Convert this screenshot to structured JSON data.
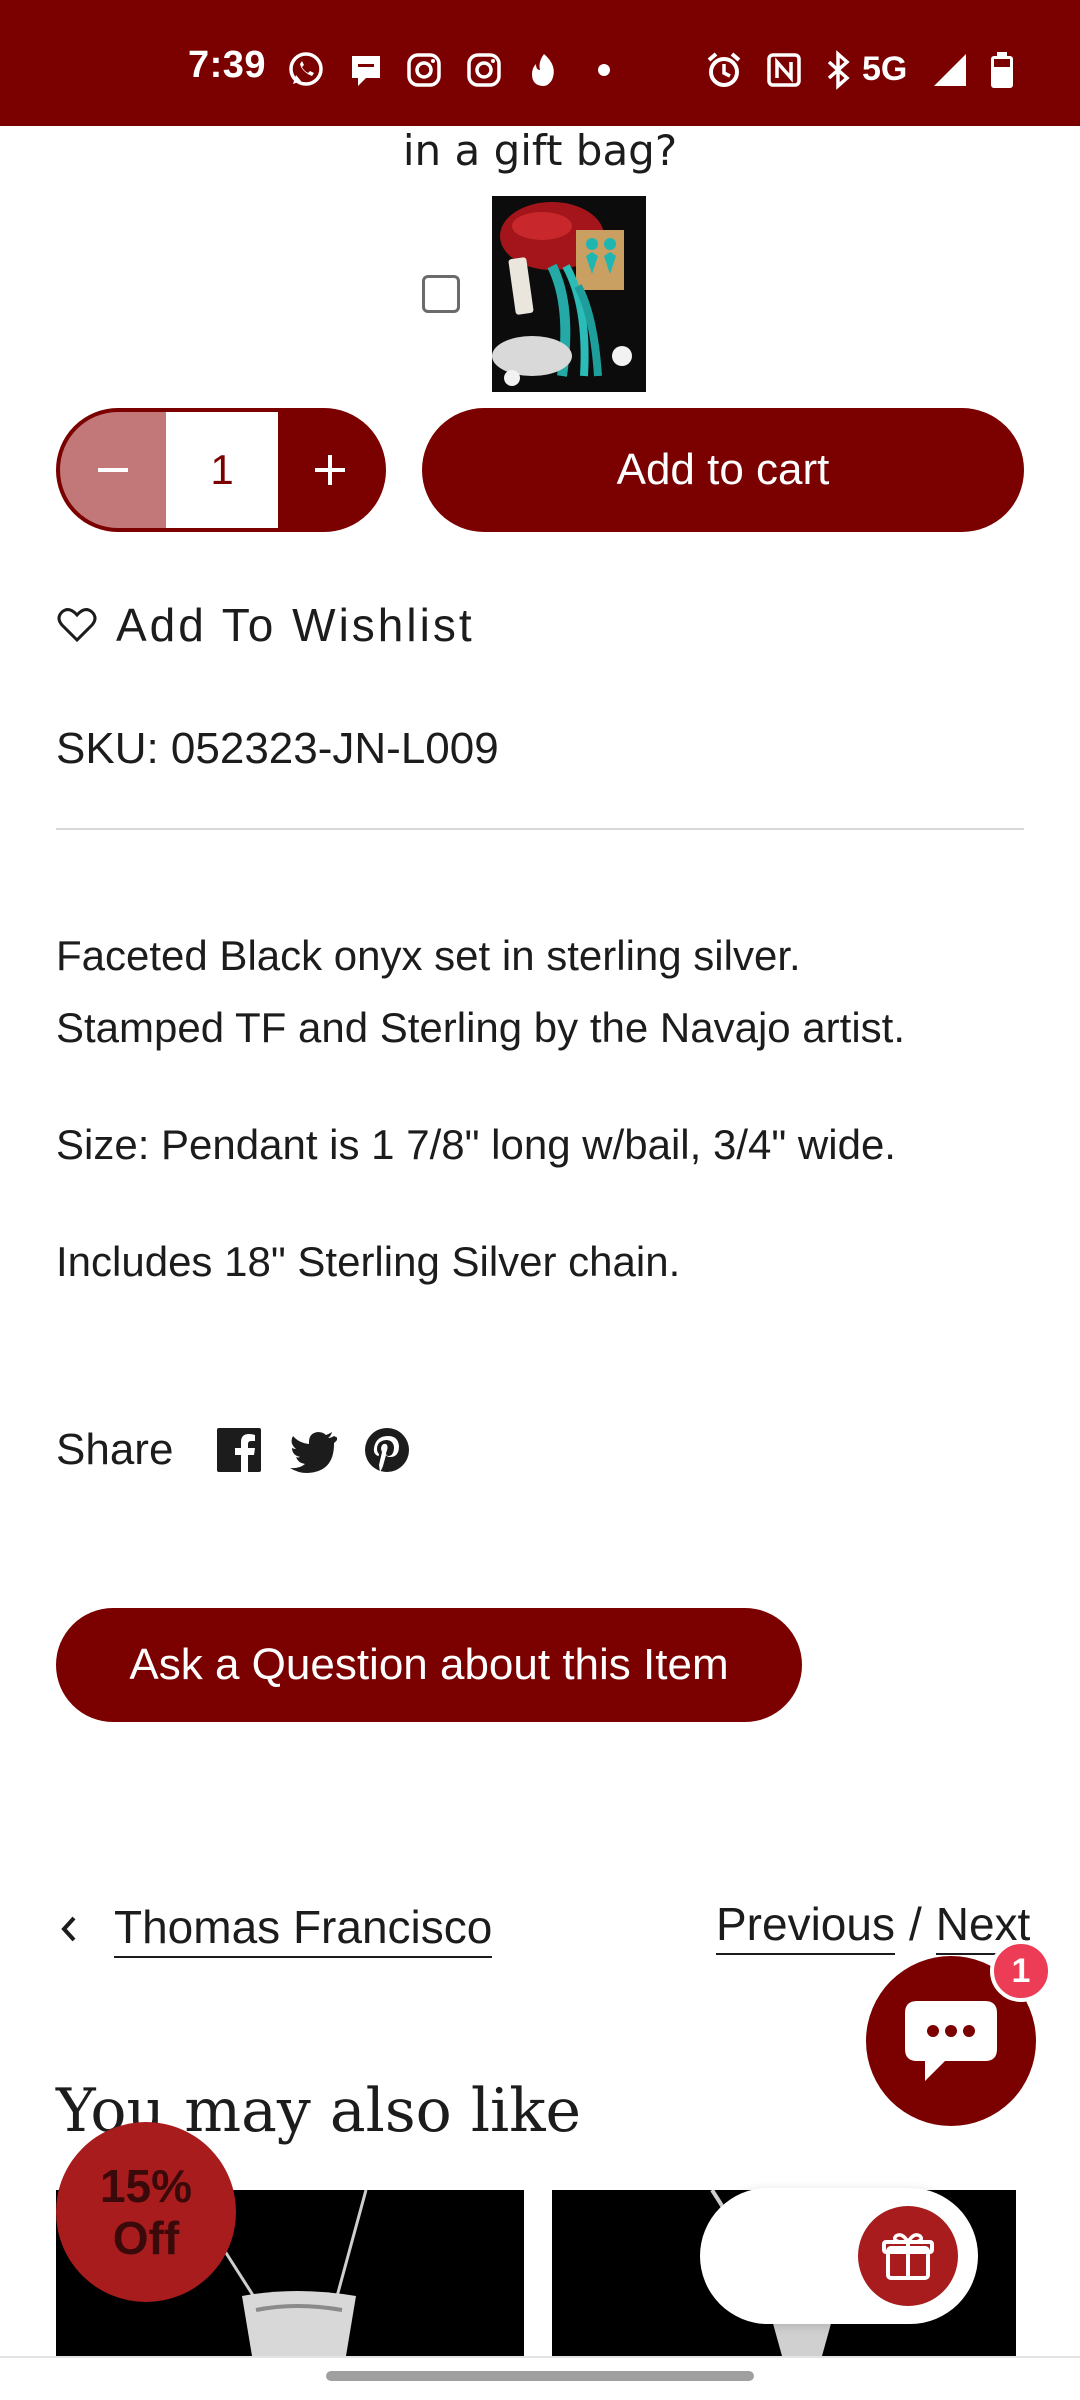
{
  "status_bar": {
    "time": "7:39",
    "network": "5G"
  },
  "gift": {
    "title": "in a gift bag?"
  },
  "quantity": {
    "value": "1"
  },
  "add_to_cart": {
    "label": "Add to cart"
  },
  "wishlist": {
    "label": "Add To Wishlist"
  },
  "sku": {
    "text": "SKU: 052323-JN-L009"
  },
  "description": {
    "line1": "Faceted Black onyx set in sterling silver.",
    "line2": "Stamped TF and Sterling by the Navajo artist.",
    "size": "Size: Pendant is 1 7/8\" long w/bail, 3/4\" wide.",
    "chain": "Includes 18\" Sterling Silver chain."
  },
  "share": {
    "label": "Share"
  },
  "ask": {
    "label": "Ask a Question about this Item"
  },
  "nav": {
    "back_label": "Thomas Francisco",
    "previous": "Previous",
    "separator": "/",
    "next": "Next"
  },
  "chat": {
    "badge_count": "1"
  },
  "recommendations": {
    "title": "You may also like"
  },
  "discount": {
    "line1": "15%",
    "line2": "Off"
  },
  "colors": {
    "brand": "#7b0000",
    "brand_light": "#c27778",
    "badge": "#ec3c56"
  }
}
